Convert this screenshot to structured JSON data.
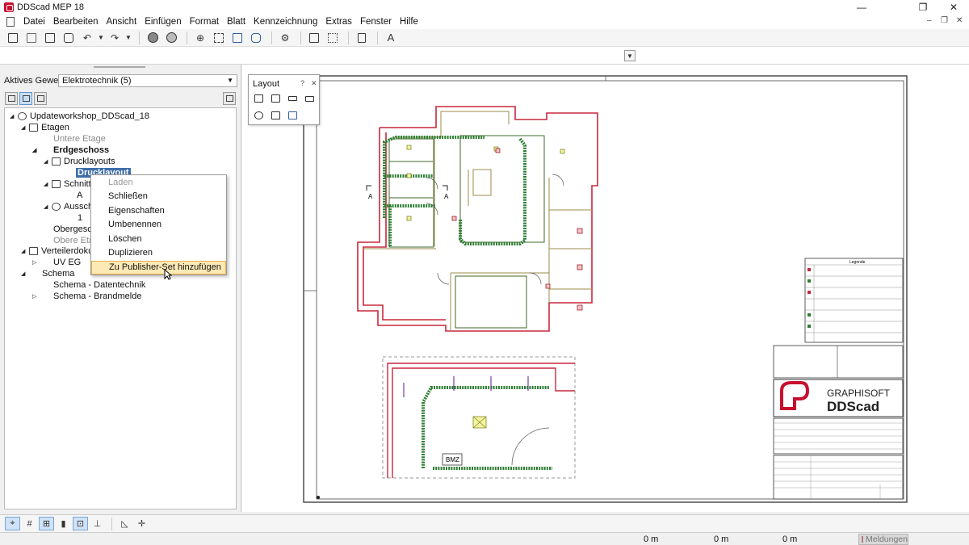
{
  "window": {
    "title": "DDScad MEP 18",
    "minimize": "—",
    "maximize": "❐",
    "close": "✕"
  },
  "menu": {
    "items": [
      "Datei",
      "Bearbeiten",
      "Ansicht",
      "Einfügen",
      "Format",
      "Blatt",
      "Kennzeichnung",
      "Extras",
      "Fenster",
      "Hilfe"
    ],
    "mdi_controls": {
      "minimize": "–",
      "restore": "❐",
      "close": "✕"
    }
  },
  "panel": {
    "gewerk_label": "Aktives Gewerk",
    "gewerk_value": "Elektrotechnik (5)",
    "dropdown_arrow": "▼"
  },
  "tree": {
    "root": "Updateworkshop_DDScad_18",
    "etagen": "Etagen",
    "untere_etage": "Untere Etage",
    "erdgeschoss": "Erdgeschoss",
    "drucklayouts": "Drucklayouts",
    "drucklayout": "Drucklayout",
    "schnitte": "Schnitte",
    "schnitt_a": "A",
    "ausschnitte": "Ausschn",
    "ausschnitt_1": "1",
    "obergeschoss": "Obergesch",
    "obere_etage": "Obere Etag",
    "verteilerdokumente": "Verteilerdokume",
    "uv_eg": "UV EG",
    "schema": "Schema",
    "schema_datentechnik": "Schema - Datentechnik",
    "schema_brandmelde": "Schema - Brandmelde"
  },
  "context_menu": {
    "items": [
      "Laden",
      "Schließen",
      "Eigenschaften",
      "Umbenennen",
      "Löschen",
      "Duplizieren",
      "Zu Publisher-Set hinzufügen"
    ]
  },
  "layout_palette": {
    "title": "Layout",
    "help": "?",
    "close": "✕"
  },
  "drawing": {
    "section_label_a": "A",
    "bmz_label": "BMZ",
    "legend_title": "Legende",
    "logo_line1": "GRAPHISOFT",
    "logo_line2": "DDScad"
  },
  "status": {
    "coord_1": "0 m",
    "coord_2": "0 m",
    "coord_3": "0 m",
    "meldungen": "Meldungen"
  },
  "colors": {
    "wall": "#c8283c",
    "cable_tray": "#2e7d32",
    "selection": "#3d6ea8",
    "menu_hover": "#fde9b6"
  }
}
